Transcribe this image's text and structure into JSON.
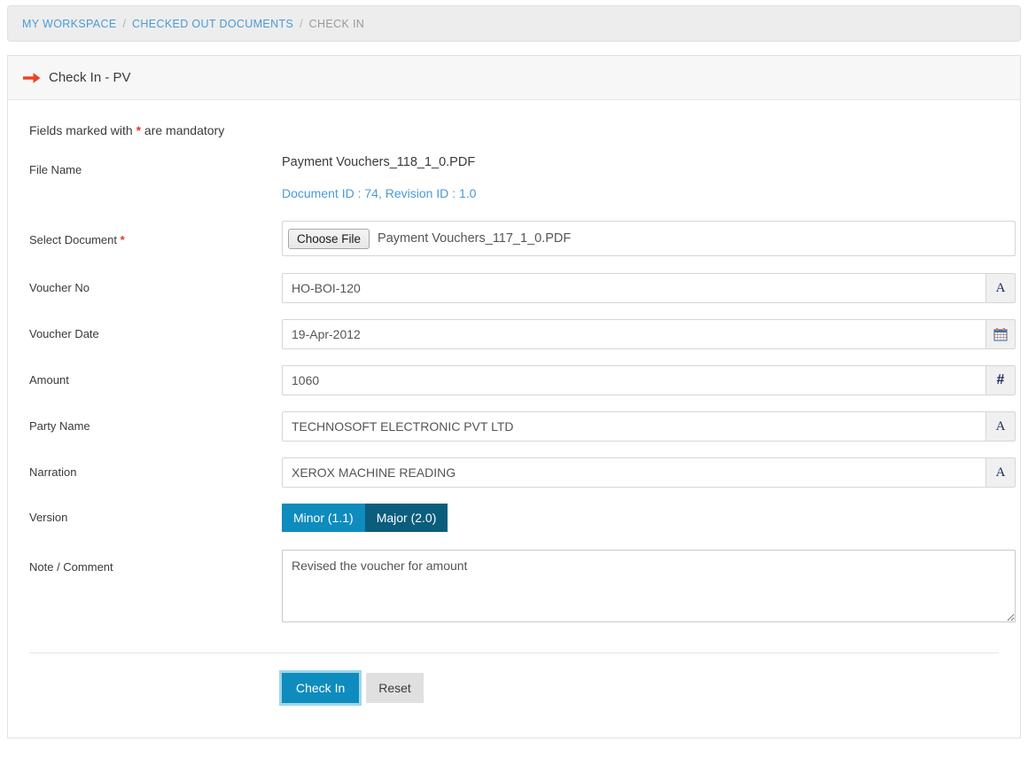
{
  "breadcrumb": {
    "items": [
      {
        "label": "MY WORKSPACE",
        "current": false
      },
      {
        "label": "CHECKED OUT DOCUMENTS",
        "current": false
      },
      {
        "label": "CHECK IN",
        "current": true
      }
    ],
    "separator": "/"
  },
  "panel": {
    "title": "Check In - PV",
    "arrow_icon": "red-arrow-right-icon",
    "mandatory_note_prefix": "Fields marked with ",
    "mandatory_star": "*",
    "mandatory_note_suffix": " are mandatory"
  },
  "form": {
    "file_name": {
      "label": "File Name",
      "value": "Payment Vouchers_118_1_0.PDF",
      "doc_id": "Document ID : 74, Revision ID : 1.0"
    },
    "select_document": {
      "label": "Select Document",
      "required_star": "*",
      "choose_button": "Choose File",
      "chosen_file": "Payment Vouchers_117_1_0.PDF"
    },
    "voucher_no": {
      "label": "Voucher No",
      "value": "HO-BOI-120",
      "placeholder": "",
      "addon_icon": "text-a-icon",
      "addon_glyph": "A"
    },
    "voucher_date": {
      "label": "Voucher Date",
      "value": "19-Apr-2012",
      "placeholder": "",
      "addon_icon": "calendar-icon"
    },
    "amount": {
      "label": "Amount",
      "value": "1060",
      "placeholder": "",
      "addon_icon": "hash-number-icon",
      "addon_glyph": "#"
    },
    "party_name": {
      "label": "Party Name",
      "value": "TECHNOSOFT ELECTRONIC PVT LTD",
      "placeholder": "",
      "addon_icon": "text-a-icon",
      "addon_glyph": "A"
    },
    "narration": {
      "label": "Narration",
      "value": "XEROX MACHINE READING",
      "placeholder": "",
      "addon_icon": "text-a-icon",
      "addon_glyph": "A"
    },
    "version": {
      "label": "Version",
      "options": [
        {
          "label": "Minor (1.1)",
          "selected": true
        },
        {
          "label": "Major (2.0)",
          "selected": false
        }
      ]
    },
    "note": {
      "label": "Note / Comment",
      "value": "Revised the voucher for amount",
      "placeholder": ""
    }
  },
  "actions": {
    "submit_label": "Check In",
    "reset_label": "Reset"
  },
  "colors": {
    "link_blue": "#4a9ad4",
    "accent_blue": "#0e8cbd",
    "accent_dark_blue": "#0a5d7c",
    "required_red": "#e8392c",
    "focus_ring": "#9cd7ec"
  }
}
